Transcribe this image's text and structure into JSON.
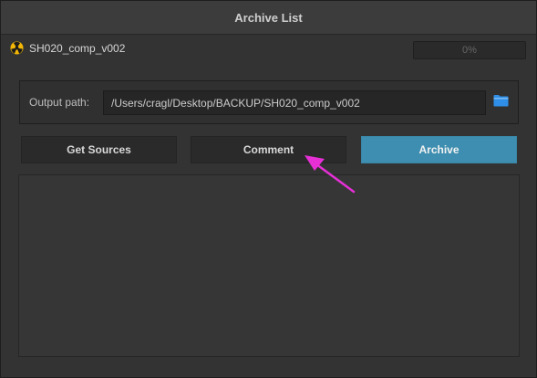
{
  "window": {
    "title": "Archive List"
  },
  "item": {
    "name": "SH020_comp_v002",
    "icon": "nuke-icon",
    "progress_text": "0%",
    "progress": 0
  },
  "output": {
    "label": "Output path:",
    "value": "/Users/cragl/Desktop/BACKUP/SH020_comp_v002",
    "browse_icon": "folder-icon"
  },
  "buttons": {
    "get_sources": "Get Sources",
    "comment": "Comment",
    "archive": "Archive"
  },
  "colors": {
    "accent": "#3d8eb0",
    "annotation_arrow": "#e630d6"
  }
}
